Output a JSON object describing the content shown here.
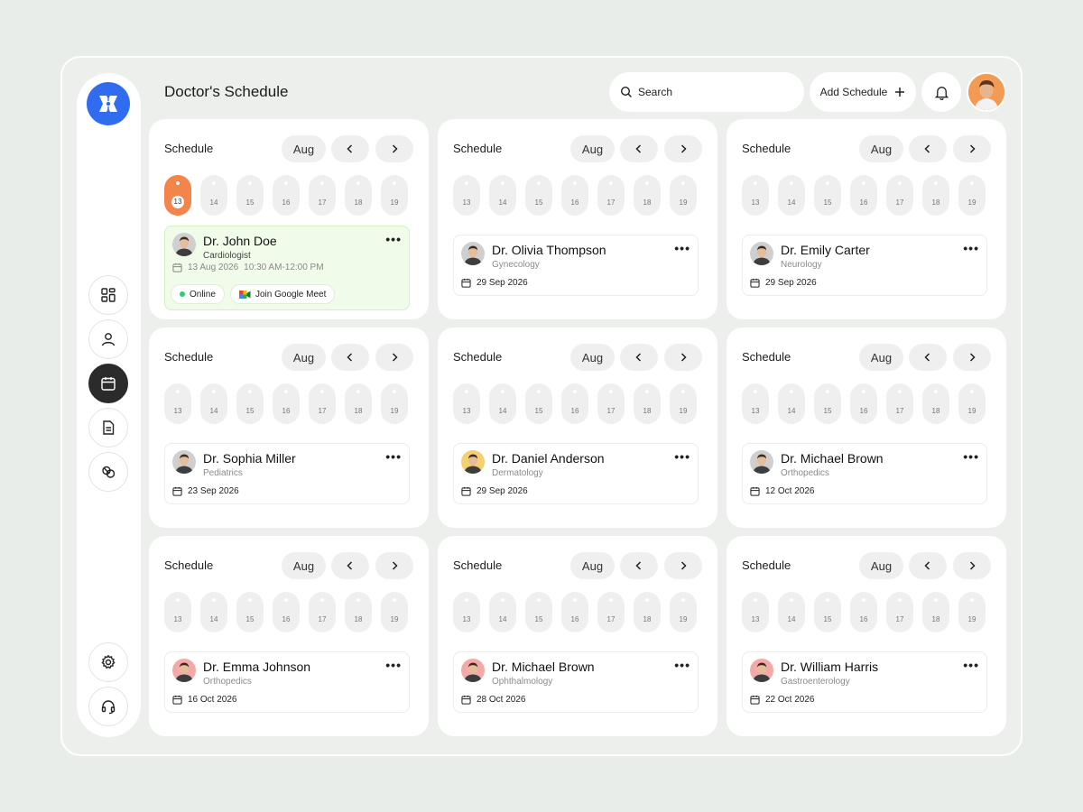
{
  "header": {
    "title": "Doctor's Schedule",
    "search_placeholder": "Search",
    "add_schedule_label": "Add Schedule"
  },
  "sidebar": {
    "items": [
      {
        "icon": "dashboard-icon"
      },
      {
        "icon": "user-icon"
      },
      {
        "icon": "calendar-icon",
        "active": true
      },
      {
        "icon": "document-icon"
      },
      {
        "icon": "pills-icon"
      }
    ],
    "bottom": [
      {
        "icon": "gear-icon"
      },
      {
        "icon": "headset-icon"
      }
    ]
  },
  "colors": {
    "accent": "#2f6cf0",
    "active_day": "#f3844a",
    "featured_bg": "#f1fbea",
    "online": "#2ad06e"
  },
  "cards": [
    {
      "title": "Schedule",
      "month": "Aug",
      "days": [
        "13",
        "14",
        "15",
        "16",
        "17",
        "18",
        "19"
      ],
      "active_day": 0,
      "doctor": "Dr. John Doe",
      "specialty": "Cardiologist",
      "date": "13 Aug 2026",
      "time": "10:30 AM-12:00 PM",
      "featured": true,
      "status": "Online",
      "meet_label": "Join Google Meet",
      "avatar_color": "#cfcfcf"
    },
    {
      "title": "Schedule",
      "month": "Aug",
      "days": [
        "13",
        "14",
        "15",
        "16",
        "17",
        "18",
        "19"
      ],
      "doctor": "Dr. Olivia Thompson",
      "specialty": "Gynecology",
      "date": "29 Sep 2026",
      "avatar_color": "#cfcfcf"
    },
    {
      "title": "Schedule",
      "month": "Aug",
      "days": [
        "13",
        "14",
        "15",
        "16",
        "17",
        "18",
        "19"
      ],
      "doctor": "Dr. Emily Carter",
      "specialty": "Neurology",
      "date": "29 Sep 2026",
      "avatar_color": "#cfcfcf"
    },
    {
      "title": "Schedule",
      "month": "Aug",
      "days": [
        "13",
        "14",
        "15",
        "16",
        "17",
        "18",
        "19"
      ],
      "doctor": "Dr. Sophia Miller",
      "specialty": "Pediatrics",
      "date": "23 Sep 2026",
      "avatar_color": "#cfcfcf"
    },
    {
      "title": "Schedule",
      "month": "Aug",
      "days": [
        "13",
        "14",
        "15",
        "16",
        "17",
        "18",
        "19"
      ],
      "doctor": "Dr. Daniel Anderson",
      "specialty": "Dermatology",
      "date": "29 Sep 2026",
      "avatar_color": "#f6cf6e"
    },
    {
      "title": "Schedule",
      "month": "Aug",
      "days": [
        "13",
        "14",
        "15",
        "16",
        "17",
        "18",
        "19"
      ],
      "doctor": "Dr. Michael Brown",
      "specialty": "Orthopedics",
      "date": "12 Oct 2026",
      "avatar_color": "#cfcfcf"
    },
    {
      "title": "Schedule",
      "month": "Aug",
      "days": [
        "13",
        "14",
        "15",
        "16",
        "17",
        "18",
        "19"
      ],
      "doctor": "Dr. Emma Johnson",
      "specialty": "Orthopedics",
      "date": "16 Oct 2026",
      "avatar_color": "#f4a8a8"
    },
    {
      "title": "Schedule",
      "month": "Aug",
      "days": [
        "13",
        "14",
        "15",
        "16",
        "17",
        "18",
        "19"
      ],
      "doctor": "Dr. Michael Brown",
      "specialty": "Ophthalmology",
      "date": "28 Oct 2026",
      "avatar_color": "#f4a8a8"
    },
    {
      "title": "Schedule",
      "month": "Aug",
      "days": [
        "13",
        "14",
        "15",
        "16",
        "17",
        "18",
        "19"
      ],
      "doctor": "Dr. William Harris",
      "specialty": "Gastroenterology",
      "date": "22 Oct 2026",
      "avatar_color": "#f4a8a8"
    }
  ]
}
